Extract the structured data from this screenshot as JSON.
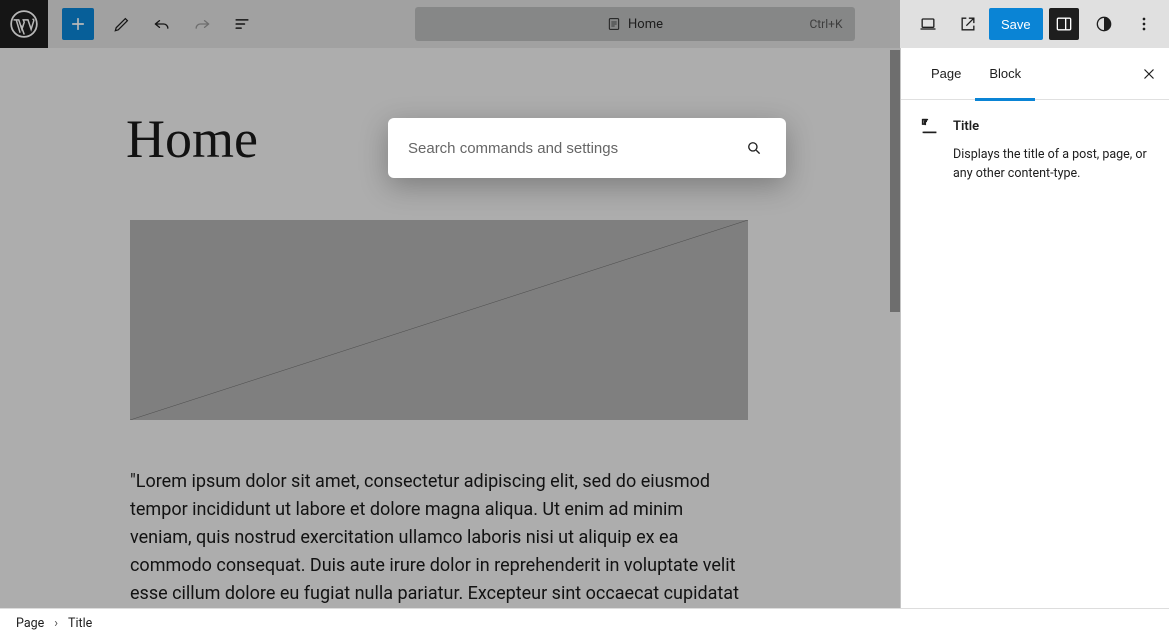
{
  "topbar": {
    "doc_title": "Home",
    "shortcut": "Ctrl+K",
    "save_label": "Save"
  },
  "command_palette": {
    "placeholder": "Search commands and settings"
  },
  "canvas": {
    "heading": "Home",
    "paragraph": "\"Lorem ipsum dolor sit amet, consectetur adipiscing elit, sed do eiusmod tempor incididunt ut labore et dolore magna aliqua. Ut enim ad minim veniam, quis nostrud exercitation ullamco laboris nisi ut aliquip ex ea commodo consequat. Duis aute irure dolor in reprehenderit in voluptate velit esse cillum dolore eu fugiat nulla pariatur. Excepteur sint occaecat cupidatat non"
  },
  "sidebar": {
    "tabs": {
      "page": "Page",
      "block": "Block"
    },
    "block": {
      "title": "Title",
      "description": "Displays the title of a post, page, or any other content-type."
    }
  },
  "breadcrumb": {
    "root": "Page",
    "current": "Title"
  }
}
